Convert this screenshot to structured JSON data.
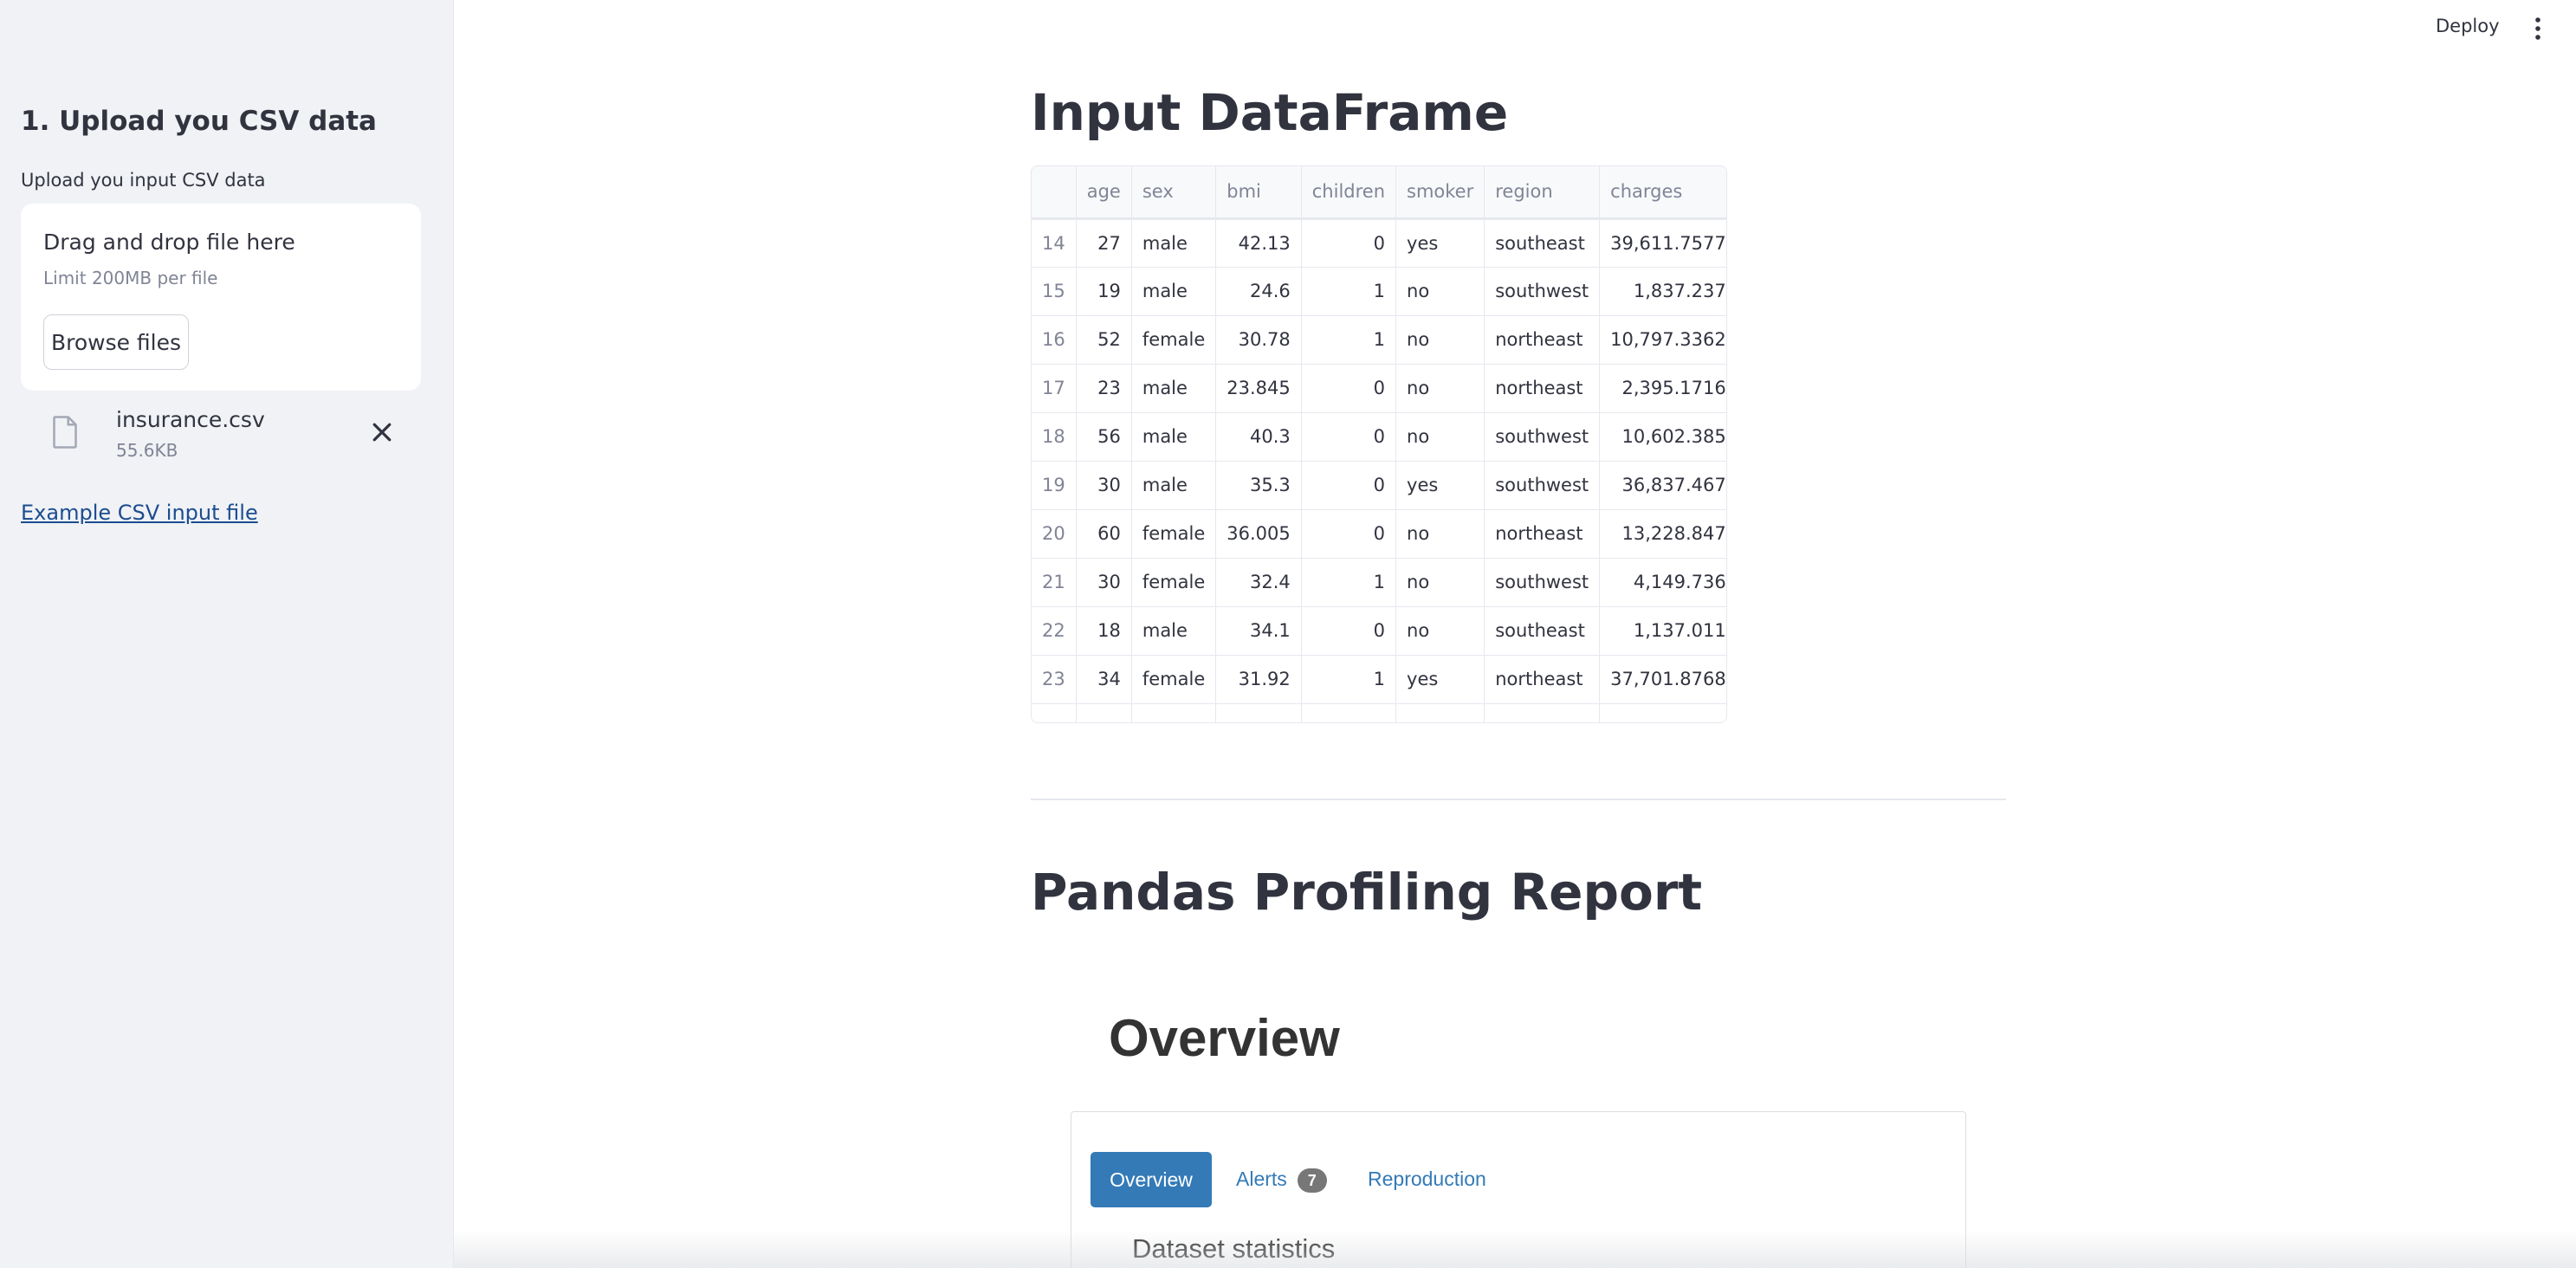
{
  "header": {
    "deploy_label": "Deploy",
    "menu_icon": "more-vertical-icon"
  },
  "sidebar": {
    "title": "1. Upload you CSV data",
    "uploader_label": "Upload you input CSV data",
    "dropzone": {
      "main_text": "Drag and drop file here",
      "limit_text": "Limit 200MB per file",
      "browse_label": "Browse files"
    },
    "file": {
      "name": "insurance.csv",
      "size": "55.6KB",
      "icon": "file-icon"
    },
    "example_link": "Example CSV input file"
  },
  "main": {
    "input_heading": "Input DataFrame",
    "dataframe": {
      "columns": [
        "",
        "age",
        "sex",
        "bmi",
        "children",
        "smoker",
        "region",
        "charges"
      ],
      "rows": [
        [
          "14",
          "27",
          "male",
          "42.13",
          "0",
          "yes",
          "southeast",
          "39,611.7577"
        ],
        [
          "15",
          "19",
          "male",
          "24.6",
          "1",
          "no",
          "southwest",
          "1,837.237"
        ],
        [
          "16",
          "52",
          "female",
          "30.78",
          "1",
          "no",
          "northeast",
          "10,797.3362"
        ],
        [
          "17",
          "23",
          "male",
          "23.845",
          "0",
          "no",
          "northeast",
          "2,395.1716"
        ],
        [
          "18",
          "56",
          "male",
          "40.3",
          "0",
          "no",
          "southwest",
          "10,602.385"
        ],
        [
          "19",
          "30",
          "male",
          "35.3",
          "0",
          "yes",
          "southwest",
          "36,837.467"
        ],
        [
          "20",
          "60",
          "female",
          "36.005",
          "0",
          "no",
          "northeast",
          "13,228.847"
        ],
        [
          "21",
          "30",
          "female",
          "32.4",
          "1",
          "no",
          "southwest",
          "4,149.736"
        ],
        [
          "22",
          "18",
          "male",
          "34.1",
          "0",
          "no",
          "southeast",
          "1,137.011"
        ],
        [
          "23",
          "34",
          "female",
          "31.92",
          "1",
          "yes",
          "northeast",
          "37,701.8768"
        ]
      ]
    },
    "profiling_heading": "Pandas Profiling Report",
    "report": {
      "overview_heading": "Overview",
      "tabs": {
        "overview": "Overview",
        "alerts": "Alerts",
        "alerts_count": "7",
        "reproduction": "Reproduction"
      },
      "section_title": "Dataset statistics"
    }
  },
  "colors": {
    "sidebar_bg": "#f0f2f6",
    "text": "#31333f",
    "link": "#1c4d8f",
    "tab_active": "#337ab7",
    "badge": "#777777"
  }
}
